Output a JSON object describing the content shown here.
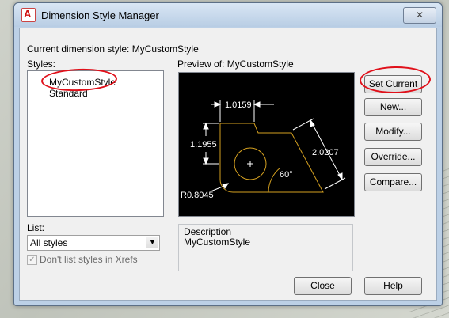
{
  "window": {
    "title": "Dimension Style Manager",
    "close_glyph": "✕"
  },
  "current_style": "Current dimension style: MyCustomStyle",
  "styles": {
    "label": "Styles:",
    "items": [
      "MyCustomStyle",
      "Standard"
    ]
  },
  "preview": {
    "label": "Preview of: MyCustomStyle",
    "dims": {
      "top": "1.0159",
      "left": "1.1955",
      "diag": "2.0207",
      "angle": "60°",
      "radius": "R0.8045"
    }
  },
  "list": {
    "label": "List:",
    "selected": "All styles"
  },
  "xrefs": {
    "label": "Don't list styles in Xrefs",
    "checked": true
  },
  "description": {
    "label": "Description",
    "text": "MyCustomStyle"
  },
  "buttons": {
    "set_current": "Set Current",
    "new": "New...",
    "modify": "Modify...",
    "override": "Override...",
    "compare": "Compare...",
    "close": "Close",
    "help": "Help"
  },
  "colors": {
    "preview_bg": "#000000",
    "geometry": "#d4a020",
    "dimension": "#ffffff",
    "annotation": "#e0101a"
  }
}
